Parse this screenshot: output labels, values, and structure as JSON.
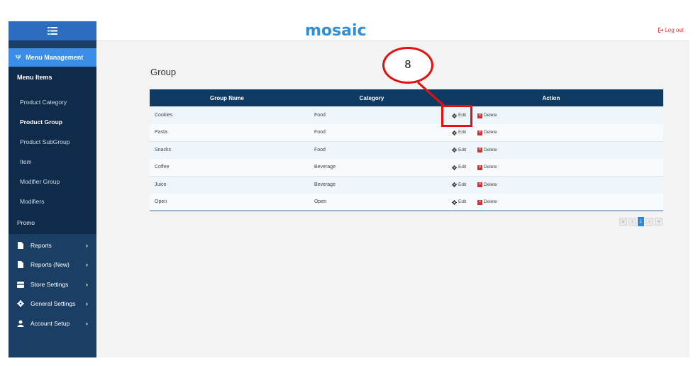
{
  "app": {
    "logo": "mosaic",
    "logout": "Log out"
  },
  "sidebar": {
    "active": "Menu Management",
    "submenu_title": "Menu Items",
    "submenu": [
      {
        "label": "Product Category",
        "bold": false
      },
      {
        "label": "Product Group",
        "bold": true
      },
      {
        "label": "Product SubGroup",
        "bold": false
      },
      {
        "label": "Item",
        "bold": false
      },
      {
        "label": "Modifier Group",
        "bold": false
      },
      {
        "label": "Modifiers",
        "bold": false
      }
    ],
    "promo": "Promo",
    "nav": [
      {
        "label": "Reports",
        "icon": "file-icon"
      },
      {
        "label": "Reports (New)",
        "icon": "file-icon"
      },
      {
        "label": "Store Settings",
        "icon": "store-icon"
      },
      {
        "label": "General Settings",
        "icon": "gear-icon"
      },
      {
        "label": "Account Setup",
        "icon": "user-icon"
      }
    ]
  },
  "main": {
    "title": "Group",
    "columns": [
      "Group Name",
      "Category",
      "Action"
    ],
    "rows": [
      {
        "name": "Cookies",
        "category": "Food"
      },
      {
        "name": "Pasta",
        "category": "Food"
      },
      {
        "name": "Snacks",
        "category": "Food"
      },
      {
        "name": "Coffee",
        "category": "Beverage"
      },
      {
        "name": "Juice",
        "category": "Beverage"
      },
      {
        "name": "Open",
        "category": "Open"
      }
    ],
    "edit_label": "Edit",
    "delete_label": "Delete",
    "pagination": {
      "first": "«",
      "prev": "‹",
      "current": "1",
      "next": "›",
      "last": "»"
    }
  },
  "annotation": {
    "step": "8"
  },
  "colors": {
    "accent": "#3b8ee8",
    "header": "#0f3a62",
    "sidebar": "#1b3f64",
    "callout": "#e31010",
    "logout": "#e0403a"
  }
}
